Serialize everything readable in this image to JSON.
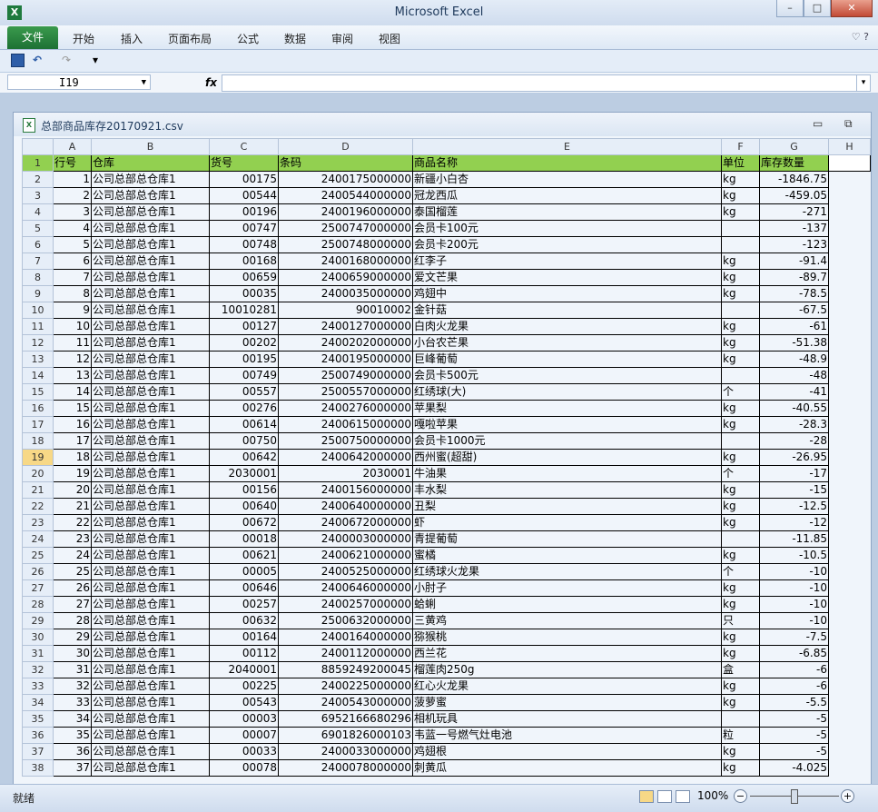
{
  "app": {
    "title": "Microsoft Excel",
    "icon": "excel-icon"
  },
  "window_controls": {
    "minimize": "–",
    "maximize": "□",
    "close": "✕"
  },
  "ribbon": {
    "file_tab": "文件",
    "tabs": [
      "开始",
      "插入",
      "页面布局",
      "公式",
      "数据",
      "审阅",
      "视图"
    ],
    "help": "♡ ?"
  },
  "qat": {
    "undo": "↶",
    "redo": "↷",
    "customize": "▾"
  },
  "formula_bar": {
    "name_box": "I19",
    "fx": "fx",
    "content": ""
  },
  "workbook": {
    "name": "总部商品库存20170921.csv",
    "minimize": "▭",
    "restore": "⧉"
  },
  "columns": [
    "A",
    "B",
    "C",
    "D",
    "E",
    "F",
    "G",
    "H"
  ],
  "selected_row": 19,
  "header_row": {
    "num": "1",
    "cells": [
      "行号",
      "仓库",
      "货号",
      "条码",
      "商品名称",
      "单位",
      "库存数量",
      ""
    ]
  },
  "rows": [
    [
      "1",
      "公司总部总仓库1",
      "00175",
      "2400175000000",
      "新疆小白杏",
      "kg",
      "-1846.75"
    ],
    [
      "2",
      "公司总部总仓库1",
      "00544",
      "2400544000000",
      "冠龙西瓜",
      "kg",
      "-459.05"
    ],
    [
      "3",
      "公司总部总仓库1",
      "00196",
      "2400196000000",
      "泰国榴莲",
      "kg",
      "-271"
    ],
    [
      "4",
      "公司总部总仓库1",
      "00747",
      "2500747000000",
      "会员卡100元",
      "",
      "-137"
    ],
    [
      "5",
      "公司总部总仓库1",
      "00748",
      "2500748000000",
      "会员卡200元",
      "",
      "-123"
    ],
    [
      "6",
      "公司总部总仓库1",
      "00168",
      "2400168000000",
      "红李子",
      "kg",
      "-91.4"
    ],
    [
      "7",
      "公司总部总仓库1",
      "00659",
      "2400659000000",
      "爱文芒果",
      "kg",
      "-89.7"
    ],
    [
      "8",
      "公司总部总仓库1",
      "00035",
      "2400035000000",
      "鸡翅中",
      "kg",
      "-78.5"
    ],
    [
      "9",
      "公司总部总仓库1",
      "10010281",
      "90010002",
      "金针菇",
      "",
      "-67.5"
    ],
    [
      "10",
      "公司总部总仓库1",
      "00127",
      "2400127000000",
      "白肉火龙果",
      "kg",
      "-61"
    ],
    [
      "11",
      "公司总部总仓库1",
      "00202",
      "2400202000000",
      "小台农芒果",
      "kg",
      "-51.38"
    ],
    [
      "12",
      "公司总部总仓库1",
      "00195",
      "2400195000000",
      "巨峰葡萄",
      "kg",
      "-48.9"
    ],
    [
      "13",
      "公司总部总仓库1",
      "00749",
      "2500749000000",
      "会员卡500元",
      "",
      "-48"
    ],
    [
      "14",
      "公司总部总仓库1",
      "00557",
      "2500557000000",
      "红绣球(大)",
      "个",
      "-41"
    ],
    [
      "15",
      "公司总部总仓库1",
      "00276",
      "2400276000000",
      "苹果梨",
      "kg",
      "-40.55"
    ],
    [
      "16",
      "公司总部总仓库1",
      "00614",
      "2400615000000",
      "嘎啦苹果",
      "kg",
      "-28.3"
    ],
    [
      "17",
      "公司总部总仓库1",
      "00750",
      "2500750000000",
      "会员卡1000元",
      "",
      "-28"
    ],
    [
      "18",
      "公司总部总仓库1",
      "00642",
      "2400642000000",
      "西州蜜(超甜)",
      "kg",
      "-26.95"
    ],
    [
      "19",
      "公司总部总仓库1",
      "2030001",
      "2030001",
      "牛油果",
      "个",
      "-17"
    ],
    [
      "20",
      "公司总部总仓库1",
      "00156",
      "2400156000000",
      "丰水梨",
      "kg",
      "-15"
    ],
    [
      "21",
      "公司总部总仓库1",
      "00640",
      "2400640000000",
      "丑梨",
      "kg",
      "-12.5"
    ],
    [
      "22",
      "公司总部总仓库1",
      "00672",
      "2400672000000",
      "虾",
      "kg",
      "-12"
    ],
    [
      "23",
      "公司总部总仓库1",
      "00018",
      "2400003000000",
      "青提葡萄",
      "",
      "-11.85"
    ],
    [
      "24",
      "公司总部总仓库1",
      "00621",
      "2400621000000",
      "蜜橘",
      "kg",
      "-10.5"
    ],
    [
      "25",
      "公司总部总仓库1",
      "00005",
      "2400525000000",
      "红绣球火龙果",
      "个",
      "-10"
    ],
    [
      "26",
      "公司总部总仓库1",
      "00646",
      "2400646000000",
      "小肘子",
      "kg",
      "-10"
    ],
    [
      "27",
      "公司总部总仓库1",
      "00257",
      "2400257000000",
      "蛤蜊",
      "kg",
      "-10"
    ],
    [
      "28",
      "公司总部总仓库1",
      "00632",
      "2500632000000",
      "三黄鸡",
      "只",
      "-10"
    ],
    [
      "29",
      "公司总部总仓库1",
      "00164",
      "2400164000000",
      "猕猴桃",
      "kg",
      "-7.5"
    ],
    [
      "30",
      "公司总部总仓库1",
      "00112",
      "2400112000000",
      "西兰花",
      "kg",
      "-6.85"
    ],
    [
      "31",
      "公司总部总仓库1",
      "2040001",
      "8859249200045",
      "榴莲肉250g",
      "盒",
      "-6"
    ],
    [
      "32",
      "公司总部总仓库1",
      "00225",
      "2400225000000",
      "红心火龙果",
      "kg",
      "-6"
    ],
    [
      "33",
      "公司总部总仓库1",
      "00543",
      "2400543000000",
      "菠萝蜜",
      "kg",
      "-5.5"
    ],
    [
      "34",
      "公司总部总仓库1",
      "00003",
      "6952166680296",
      "相机玩具",
      "",
      "-5"
    ],
    [
      "35",
      "公司总部总仓库1",
      "00007",
      "6901826000103",
      "韦蓝一号燃气灶电池",
      "粒",
      "-5"
    ],
    [
      "36",
      "公司总部总仓库1",
      "00033",
      "2400033000000",
      "鸡翅根",
      "kg",
      "-5"
    ],
    [
      "37",
      "公司总部总仓库1",
      "00078",
      "2400078000000",
      "刺黄瓜",
      "kg",
      "-4.025"
    ]
  ],
  "status": {
    "text": "就绪",
    "zoom": "100%",
    "minus": "−",
    "plus": "+"
  }
}
